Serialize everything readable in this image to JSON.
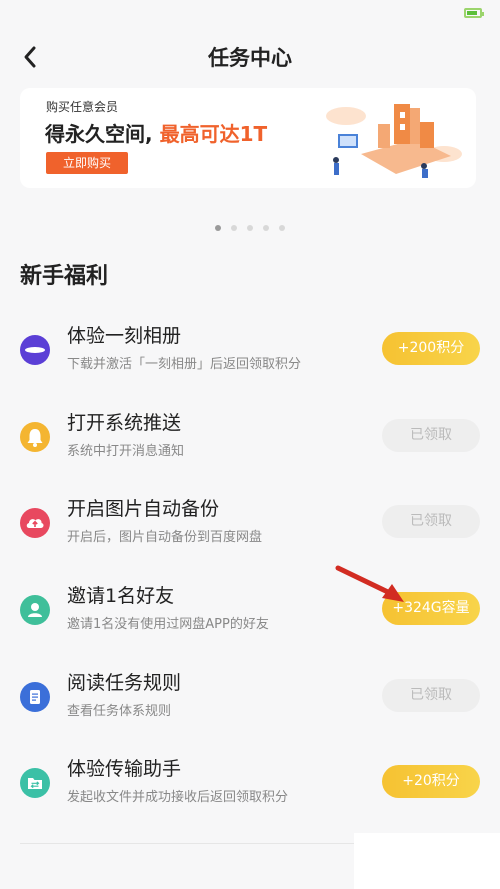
{
  "header": {
    "title": "任务中心"
  },
  "banner": {
    "subtitle": "购买任意会员",
    "main_text": "得永久空间,",
    "highlight_text": "最高可达1T",
    "button_label": "立即购买"
  },
  "carousel": {
    "dot_count": 5,
    "active_index": 0
  },
  "section": {
    "title": "新手福利"
  },
  "tasks": [
    {
      "icon": "album-icon",
      "title": "体验一刻相册",
      "desc": "下载并激活「一刻相册」后返回领取积分",
      "button": "+200积分",
      "status": "active"
    },
    {
      "icon": "bell-icon",
      "title": "打开系统推送",
      "desc": "系统中打开消息通知",
      "button": "已领取",
      "status": "done"
    },
    {
      "icon": "cloud-upload-icon",
      "title": "开启图片自动备份",
      "desc": "开启后，图片自动备份到百度网盘",
      "button": "已领取",
      "status": "done"
    },
    {
      "icon": "user-icon",
      "title": "邀请1名好友",
      "desc": "邀请1名没有使用过网盘APP的好友",
      "button": "+324G容量",
      "status": "active"
    },
    {
      "icon": "document-icon",
      "title": "阅读任务规则",
      "desc": "查看任务体系规则",
      "button": "已领取",
      "status": "done"
    },
    {
      "icon": "transfer-folder-icon",
      "title": "体验传输助手",
      "desc": "发起收文件并成功接收后返回领取积分",
      "button": "+20积分",
      "status": "active"
    }
  ],
  "colors": {
    "accent_orange": "#f0622c",
    "button_yellow": "#f6c232",
    "done_gray": "#eeeeee",
    "arrow_red": "#d22c22"
  }
}
